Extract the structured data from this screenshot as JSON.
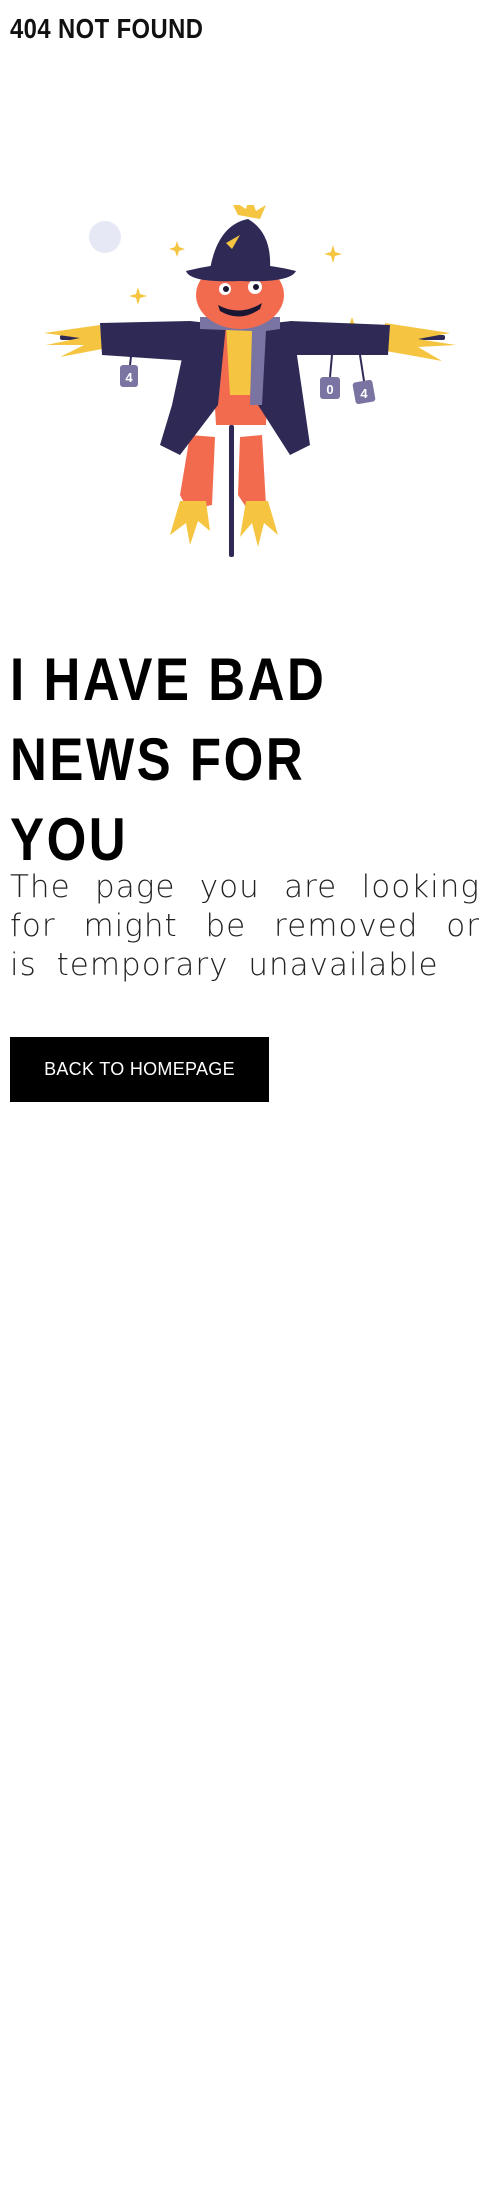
{
  "header": {
    "brand_title": "404 NOT FOUND"
  },
  "illustration": {
    "name": "scarecrow-404-illustration",
    "tag_digits": [
      "4",
      "0",
      "4"
    ]
  },
  "main": {
    "headline": "I HAVE BAD NEWS FOR YOU",
    "message": "The page you are looking for might be removed or is temporary unavailable",
    "button_label": "BACK TO HOMEPAGE"
  },
  "colors": {
    "background": "#ffffff",
    "text": "#000000",
    "button_bg": "#000000",
    "button_text": "#ffffff",
    "hat_coat": "#2f2a55",
    "face": "#f36b4f",
    "straw": "#f5c542",
    "tags": "#7a74a3"
  }
}
